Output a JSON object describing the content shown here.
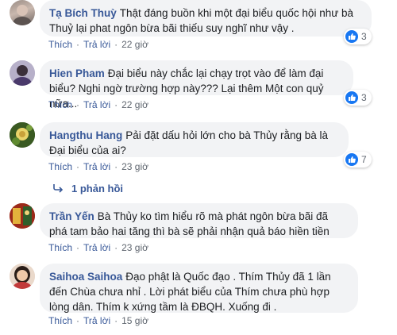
{
  "comments": [
    {
      "author": "Tạ Bích Thuỳ",
      "text": "Thật đáng buồn khi một đại biểu quốc hội như bà Thuỷ lại phat ngôn bừa bãi thiếu suy nghĩ như vậy .",
      "like": "Thích",
      "reply": "Trả lời",
      "time": "22 giờ",
      "reactions": "3"
    },
    {
      "author": "Hien Pham",
      "text": "Đại biểu này chắc lại chạy trọt vào để làm đại biểu? Nghi ngờ trường hợp này??? Lại thêm Một con quỷ nữa...",
      "like": "Thích",
      "reply": "Trả lời",
      "time": "22 giờ",
      "reactions": "3"
    },
    {
      "author": "Hangthu Hang",
      "text": "Pải đặt dấu hỏi lớn cho bà Thủy rằng bà là Đại biểu của ai?",
      "like": "Thích",
      "reply": "Trả lời",
      "time": "23 giờ",
      "reactions": "7",
      "replies": "1 phản hồi"
    },
    {
      "author": "Trần Yến",
      "text": "Bà Thủy ko tìm hiểu rõ mà phát ngôn bừa bãi đã phá tam bảo hai tăng thì bà sẽ phải nhận quả báo hiền tiền",
      "like": "Thích",
      "reply": "Trả lời",
      "time": "23 giờ"
    },
    {
      "author": "Saihoa Saihoa",
      "text": "Đạo phật là Quốc đạo . Thím Thủy đã 1 lần đến Chùa chưa nhỉ . Lời phát biểu của Thím chưa phù hợp lòng dân. Thím k xứng tầm là ĐBQH. Xuống đi .",
      "like": "Thích",
      "reply": "Trả lời",
      "time": "15 giờ"
    }
  ],
  "colors": {
    "link": "#385898",
    "bubble": "#f2f3f5",
    "like_blue": "#1877f2",
    "meta": "#606770"
  },
  "icons": [
    "avatar",
    "like-thumb-icon",
    "reply-arrow-icon"
  ]
}
